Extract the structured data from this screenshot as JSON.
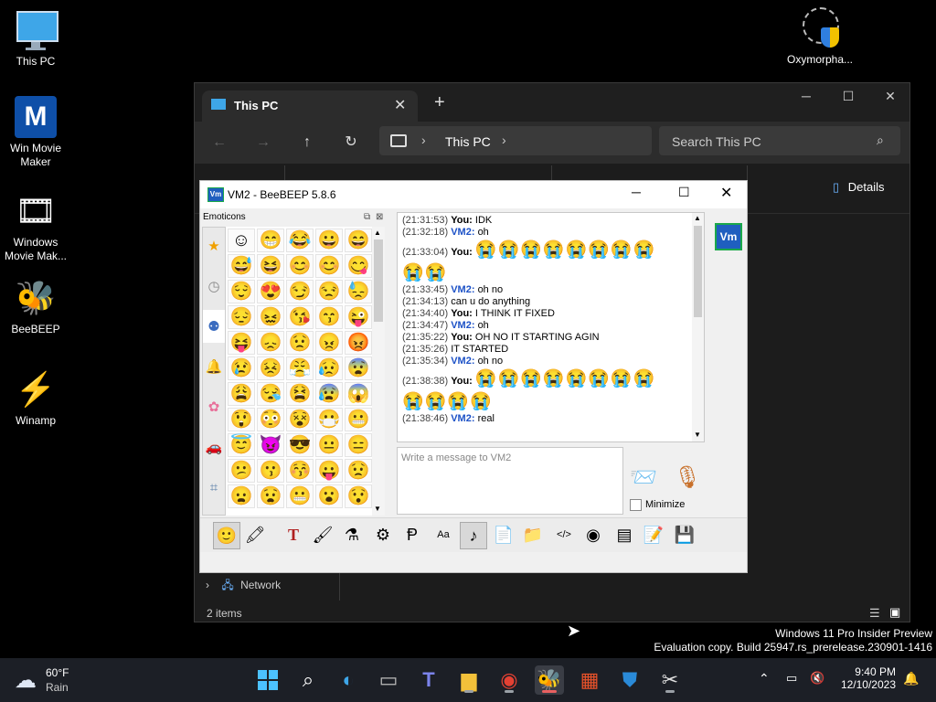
{
  "desktop": {
    "icons": [
      {
        "label": "This PC",
        "icon": "monitor-icon"
      },
      {
        "label": "Win Movie Maker",
        "icon": "movie-maker-icon"
      },
      {
        "label": "Windows Movie Mak...",
        "icon": "film-reel-icon"
      },
      {
        "label": "BeeBEEP",
        "icon": "bee-icon"
      },
      {
        "label": "Winamp",
        "icon": "winamp-icon"
      },
      {
        "label": "Oxymorpha...",
        "icon": "installer-shield-icon"
      }
    ],
    "watermark_line1": "Windows 11 Pro Insider Preview",
    "watermark_line2": "Evaluation copy. Build 25947.rs_prerelease.230901-1416"
  },
  "explorer": {
    "tab_title": "This PC",
    "breadcrumb": "This PC",
    "search_placeholder": "Search This PC",
    "details_label": "Details",
    "nav_item": "Network",
    "status": "2 items"
  },
  "beebeep": {
    "title": "VM2 - BeeBEEP 5.8.6",
    "emoticons_label": "Emoticons",
    "emoticons": [
      "☺",
      "😁",
      "😂",
      "😀",
      "😄",
      "😅",
      "😆",
      "😊",
      "😊",
      "😋",
      "😌",
      "😍",
      "😏",
      "😒",
      "😓",
      "😔",
      "😖",
      "😘",
      "😙",
      "😜",
      "😝",
      "😞",
      "😟",
      "😠",
      "😡",
      "😢",
      "😣",
      "😤",
      "😥",
      "😨",
      "😩",
      "😪",
      "😫",
      "😰",
      "😱",
      "😲",
      "😳",
      "😵",
      "😷",
      "😬",
      "😇",
      "😈",
      "😎",
      "😐",
      "😑",
      "😕",
      "😗",
      "😚",
      "😛",
      "😟",
      "😦",
      "😧",
      "😬",
      "😮",
      "😯"
    ],
    "categories": [
      "star-icon",
      "clock-icon",
      "people-icon",
      "bell-icon",
      "flower-icon",
      "car-icon",
      "symbols-icon"
    ],
    "messages": [
      {
        "time": "(21:31:53)",
        "sender": "You:",
        "text": "IDK",
        "kind": "you"
      },
      {
        "time": "(21:32:18)",
        "sender": "VM2:",
        "text": "oh",
        "kind": "vm"
      },
      {
        "time": "(21:33:04)",
        "sender": "You:",
        "text": "😭😭😭😭😭😭😭😭",
        "kind": "you"
      },
      {
        "time": "",
        "sender": "",
        "text": "😭😭",
        "kind": "cont"
      },
      {
        "time": "(21:33:45)",
        "sender": "VM2:",
        "text": "oh no",
        "kind": "vm"
      },
      {
        "time": "(21:34:13)",
        "sender": "",
        "text": "  can u do anything",
        "kind": "plain"
      },
      {
        "time": "(21:34:40)",
        "sender": "You:",
        "text": "I THINK IT FIXED",
        "kind": "you"
      },
      {
        "time": "(21:34:47)",
        "sender": "VM2:",
        "text": "oh",
        "kind": "vm"
      },
      {
        "time": "(21:35:22)",
        "sender": "You:",
        "text": "OH NO IT STARTING AGIN",
        "kind": "you"
      },
      {
        "time": "(21:35:26)",
        "sender": "",
        "text": "  IT STARTED",
        "kind": "plain"
      },
      {
        "time": "(21:35:34)",
        "sender": "VM2:",
        "text": "oh no",
        "kind": "vm"
      },
      {
        "time": "(21:38:38)",
        "sender": "You:",
        "text": "😭😭😭😭😭😭😭😭",
        "kind": "you"
      },
      {
        "time": "",
        "sender": "",
        "text": "😭😭😭😭",
        "kind": "cont"
      },
      {
        "time": "(21:38:46)",
        "sender": "VM2:",
        "text": "real",
        "kind": "vm"
      }
    ],
    "input_placeholder": "Write a message to VM2",
    "minimize_label": "Minimize",
    "avatar_text": "Vm"
  },
  "taskbar": {
    "weather_temp": "60°F",
    "weather_desc": "Rain",
    "time": "9:40 PM",
    "date": "12/10/2023"
  },
  "colors": {
    "accent": "#0078d4",
    "vm_name": "#1d52c7",
    "avatar_bg": "#1f5fbf",
    "avatar_border": "#1aa84a"
  }
}
